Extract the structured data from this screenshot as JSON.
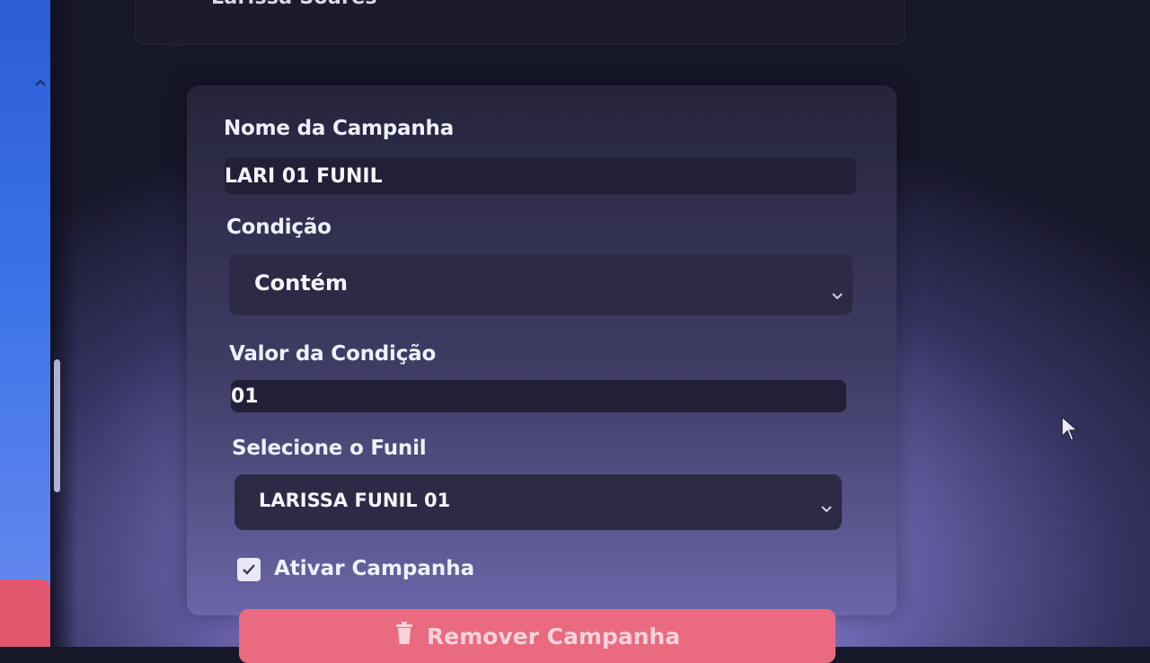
{
  "header": {
    "user_name": "Larissa Soares"
  },
  "form": {
    "campaign_name": {
      "label": "Nome da Campanha",
      "value": "LARI 01 FUNIL"
    },
    "condition": {
      "label": "Condição",
      "selected": "Contém"
    },
    "condition_value": {
      "label": "Valor da Condição",
      "value": "01"
    },
    "funnel": {
      "label": "Selecione o Funil",
      "selected": "LARISSA FUNIL 01"
    },
    "activate": {
      "label": "Ativar Campanha",
      "checked": true
    },
    "remove_button": {
      "label": "Remover Campanha",
      "icon": "trash-icon"
    }
  },
  "colors": {
    "accent_blue": "#3c73e8",
    "danger": "#ea6a80",
    "card_bg": "#25243a"
  }
}
